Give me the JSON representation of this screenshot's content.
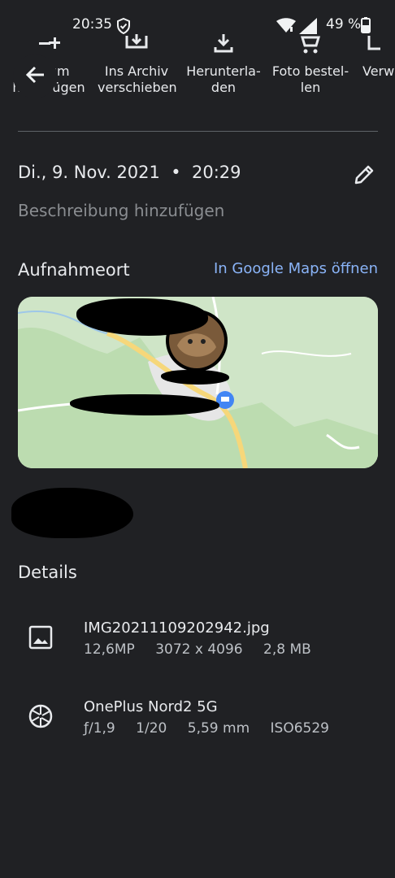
{
  "status_bar": {
    "time": "20:35",
    "battery": "49 %"
  },
  "actions": [
    {
      "label": "Album\nhinzufügen",
      "icon": "playlist-add-icon"
    },
    {
      "label": "Ins Archiv\nverschieben",
      "icon": "archive-icon"
    },
    {
      "label": "Herunterla-\nden",
      "icon": "download-icon"
    },
    {
      "label": "Foto bestel-\nlen",
      "icon": "cart-icon"
    },
    {
      "label": "Verw",
      "icon": "use-as-icon"
    }
  ],
  "info": {
    "date": "Di., 9. Nov. 2021  •  20:29",
    "description_placeholder": "Beschreibung hinzufügen"
  },
  "location": {
    "title": "Aufnahmeort",
    "maps_link": "In Google Maps öffnen"
  },
  "details": {
    "title": "Details",
    "file": {
      "name": "IMG20211109202942.jpg",
      "megapixels": "12,6MP",
      "resolution": "3072 x 4096",
      "size": "2,8 MB"
    },
    "camera": {
      "model": "OnePlus Nord2 5G",
      "aperture": "ƒ/1,9",
      "shutter": "1/20",
      "focal": "5,59 mm",
      "iso": "ISO6529"
    }
  },
  "colors": {
    "background": "#202124",
    "link": "#8ab4f8",
    "map_green": "#cfe5c7",
    "road": "#f6d77a"
  }
}
